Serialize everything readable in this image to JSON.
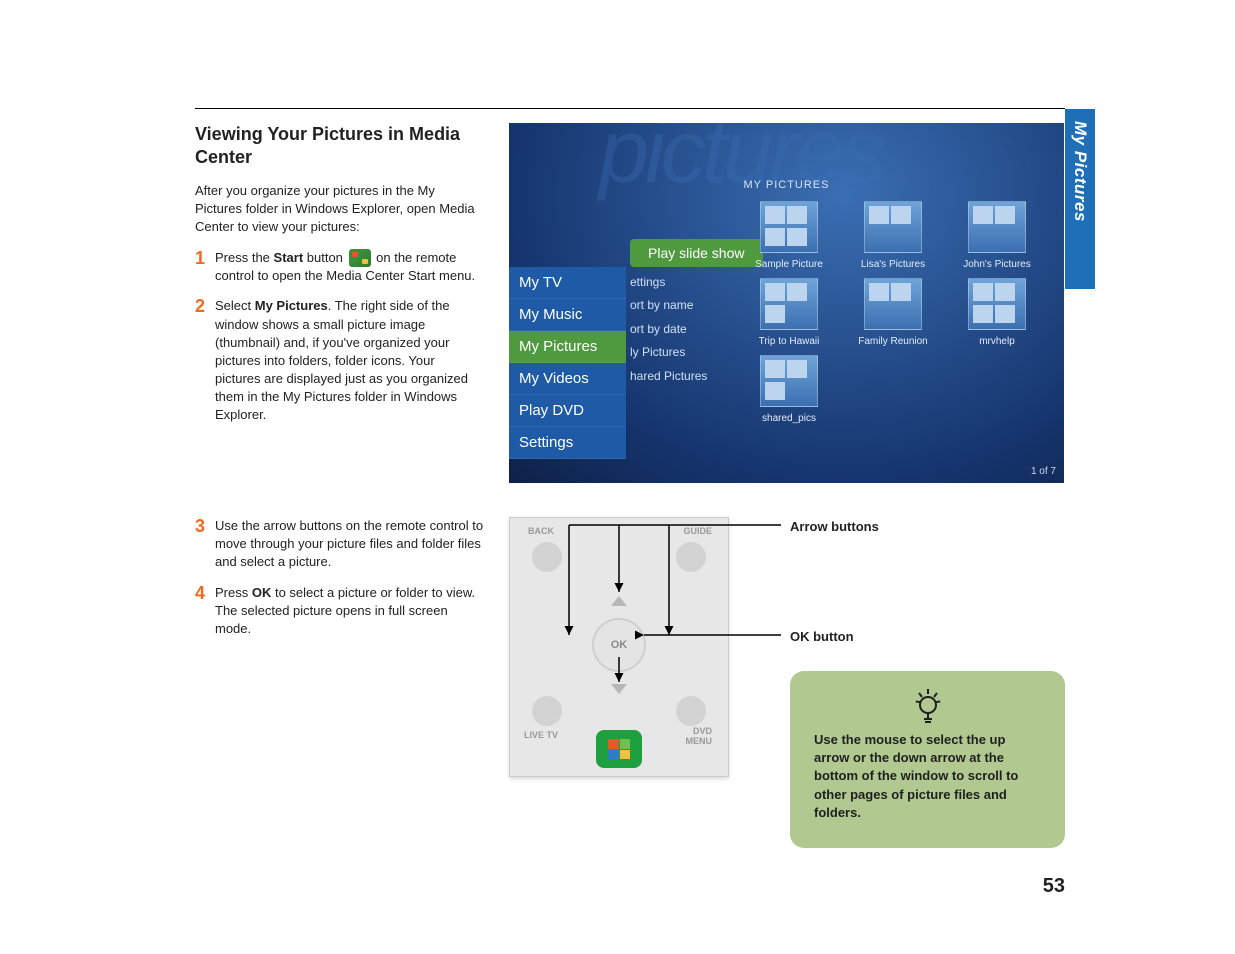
{
  "sideTab": "My Pictures",
  "title": "Viewing Your Pictures in Media Center",
  "intro": "After you organize your pictures in the My Pictures folder in Windows Explorer, open Media Center to view your pictures:",
  "steps": {
    "s1a": "Press the ",
    "s1bold": "Start",
    "s1b": " button ",
    "s1c": " on the remote control to open the Media Center Start menu.",
    "s2a": "Select ",
    "s2bold": "My Pictures",
    "s2b": ". The right side of the window shows a small picture image (thumbnail) and, if you've organized your pictures into folders, folder icons. Your pictures are displayed just as you organized them in the My Pictures folder in Windows Explorer.",
    "s3": "Use the arrow buttons on the remote control to move through your picture files and folder files and select a picture.",
    "s4a": "Press ",
    "s4bold": "OK",
    "s4b": " to select a picture or folder to view. The selected picture opens in full screen mode."
  },
  "mc": {
    "bgword": "pictures",
    "header": "MY PICTURES",
    "play": "Play slide show",
    "submenu": [
      "ettings",
      "ort by name",
      "ort by date",
      "ly Pictures",
      "hared Pictures"
    ],
    "nav": [
      "My TV",
      "My Music",
      "My Pictures",
      "My Videos",
      "Play DVD",
      "Settings"
    ],
    "navActive": "My Pictures",
    "items": [
      "Sample Picture",
      "Lisa's Pictures",
      "John's Pictures",
      "Trip to Hawaii",
      "Family Reunion",
      "mrvhelp",
      "shared_pics"
    ],
    "counter": "1 of 7"
  },
  "remote": {
    "back": "BACK",
    "guide": "GUIDE",
    "ok": "OK",
    "livetv": "LIVE TV",
    "dvdmenu": "DVD MENU"
  },
  "callouts": {
    "arrows": "Arrow buttons",
    "ok": "OK button"
  },
  "tip": "Use the mouse to select the up arrow or the down arrow at the bottom of the window to scroll to other pages of picture files and folders.",
  "pageNum": "53"
}
